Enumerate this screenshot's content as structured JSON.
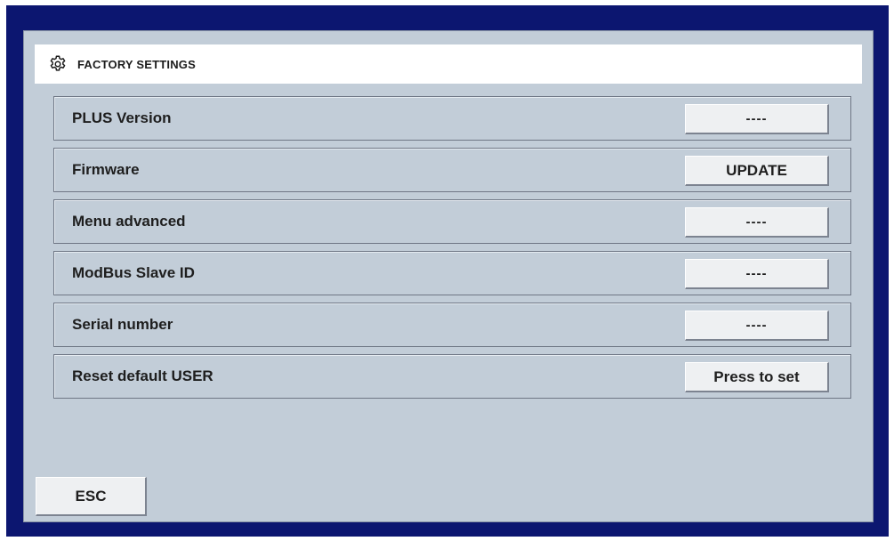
{
  "header": {
    "title": "FACTORY SETTINGS",
    "icon": "gear-icon"
  },
  "settings": [
    {
      "label": "PLUS Version",
      "button": "----"
    },
    {
      "label": "Firmware",
      "button": "UPDATE"
    },
    {
      "label": "Menu advanced",
      "button": "----"
    },
    {
      "label": "ModBus Slave ID",
      "button": "----"
    },
    {
      "label": "Serial number",
      "button": "----"
    },
    {
      "label": "Reset default USER",
      "button": "Press to set"
    }
  ],
  "footer": {
    "esc_label": "ESC"
  },
  "colors": {
    "frame": "#0c1670",
    "panel": "#c2cdd8",
    "button": "#eef0f2"
  }
}
